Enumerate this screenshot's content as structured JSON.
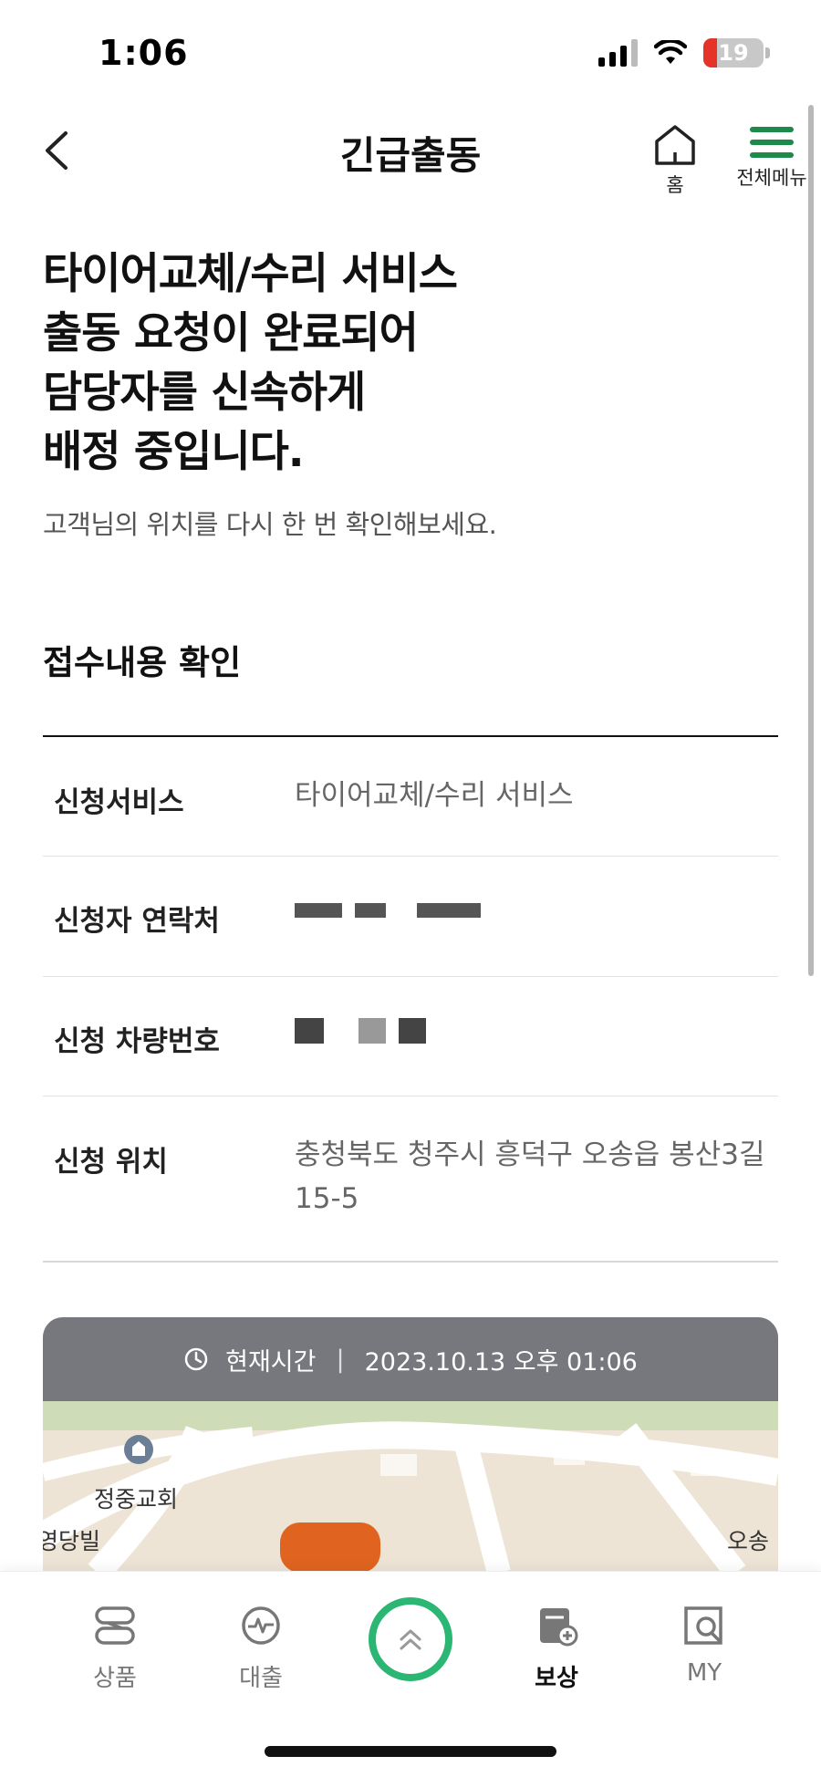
{
  "status_bar": {
    "time": "1:06",
    "battery": "19"
  },
  "header": {
    "title": "긴급출동",
    "home_label": "홈",
    "menu_label": "전체메뉴"
  },
  "headline": {
    "lines": [
      "타이어교체/수리 서비스",
      "출동 요청이 완료되어",
      "담당자를 신속하게",
      "배정 중입니다."
    ],
    "subtext": "고객님의 위치를 다시 한 번 확인해보세요."
  },
  "section": {
    "title": "접수내용 확인"
  },
  "details": [
    {
      "label": "신청서비스",
      "value": "타이어교체/수리 서비스"
    },
    {
      "label": "신청자 연락처",
      "value": ""
    },
    {
      "label": "신청 차량번호",
      "value": ""
    },
    {
      "label": "신청 위치",
      "value": "충청북도 청주시 흥덕구 오송읍 봉산3길 15-5"
    }
  ],
  "map": {
    "time_label": "현재시간",
    "separator": "|",
    "time_value": "2023.10.13 오후 01:06",
    "places": [
      "정중교회",
      "영당빌",
      "오송"
    ]
  },
  "bottom_nav": {
    "items": [
      "상품",
      "대출",
      "보상",
      "MY"
    ],
    "active": "보상"
  },
  "colors": {
    "accent_green": "#1d8a4b",
    "ring_green": "#2bb673"
  }
}
